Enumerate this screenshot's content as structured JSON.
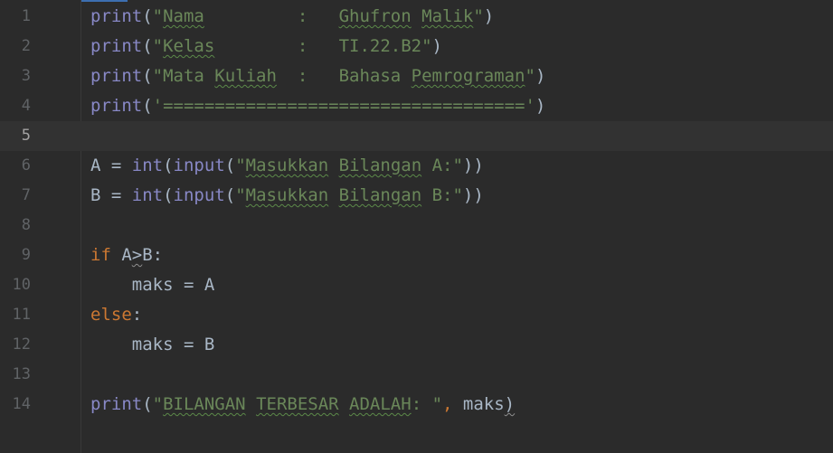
{
  "editor": {
    "colors": {
      "background": "#2b2b2b",
      "current_line": "#323232",
      "function": "#8888c6",
      "string": "#6a8759",
      "keyword": "#cc7832",
      "text": "#a9b7c6",
      "line_number": "#606366"
    },
    "current_line": 5,
    "lines": [
      {
        "num": "1",
        "tokens": [
          {
            "t": "print",
            "c": "fn"
          },
          {
            "t": "(",
            "c": "punc"
          },
          {
            "t": "\"",
            "c": "str"
          },
          {
            "t": "Nama",
            "c": "str typo"
          },
          {
            "t": "         :   ",
            "c": "str"
          },
          {
            "t": "Ghufron",
            "c": "str typo"
          },
          {
            "t": " ",
            "c": "str"
          },
          {
            "t": "Malik",
            "c": "str typo"
          },
          {
            "t": "\"",
            "c": "str"
          },
          {
            "t": ")",
            "c": "punc"
          }
        ]
      },
      {
        "num": "2",
        "tokens": [
          {
            "t": "print",
            "c": "fn"
          },
          {
            "t": "(",
            "c": "punc"
          },
          {
            "t": "\"",
            "c": "str"
          },
          {
            "t": "Kelas",
            "c": "str typo"
          },
          {
            "t": "        :   TI.22.B2\"",
            "c": "str"
          },
          {
            "t": ")",
            "c": "punc"
          }
        ]
      },
      {
        "num": "3",
        "tokens": [
          {
            "t": "print",
            "c": "fn"
          },
          {
            "t": "(",
            "c": "punc"
          },
          {
            "t": "\"Mata ",
            "c": "str"
          },
          {
            "t": "Kuliah",
            "c": "str typo"
          },
          {
            "t": "  :   Bahasa ",
            "c": "str"
          },
          {
            "t": "Pemrograman",
            "c": "str typo"
          },
          {
            "t": "\"",
            "c": "str"
          },
          {
            "t": ")",
            "c": "punc"
          }
        ]
      },
      {
        "num": "4",
        "tokens": [
          {
            "t": "print",
            "c": "fn"
          },
          {
            "t": "(",
            "c": "punc"
          },
          {
            "t": "'==================================='",
            "c": "str"
          },
          {
            "t": ")",
            "c": "punc"
          }
        ]
      },
      {
        "num": "5",
        "tokens": []
      },
      {
        "num": "6",
        "tokens": [
          {
            "t": "A = ",
            "c": "punc"
          },
          {
            "t": "int",
            "c": "fn"
          },
          {
            "t": "(",
            "c": "punc"
          },
          {
            "t": "input",
            "c": "fn"
          },
          {
            "t": "(",
            "c": "punc"
          },
          {
            "t": "\"",
            "c": "str"
          },
          {
            "t": "Masukkan",
            "c": "str typo"
          },
          {
            "t": " ",
            "c": "str"
          },
          {
            "t": "Bilangan",
            "c": "str typo"
          },
          {
            "t": " A:\"",
            "c": "str"
          },
          {
            "t": "))",
            "c": "punc"
          }
        ]
      },
      {
        "num": "7",
        "tokens": [
          {
            "t": "B = ",
            "c": "punc"
          },
          {
            "t": "int",
            "c": "fn"
          },
          {
            "t": "(",
            "c": "punc"
          },
          {
            "t": "input",
            "c": "fn"
          },
          {
            "t": "(",
            "c": "punc"
          },
          {
            "t": "\"",
            "c": "str"
          },
          {
            "t": "Masukkan",
            "c": "str typo"
          },
          {
            "t": " ",
            "c": "str"
          },
          {
            "t": "Bilangan",
            "c": "str typo"
          },
          {
            "t": " B:\"",
            "c": "str"
          },
          {
            "t": "))",
            "c": "punc"
          }
        ]
      },
      {
        "num": "8",
        "tokens": []
      },
      {
        "num": "9",
        "tokens": [
          {
            "t": "if",
            "c": "kw"
          },
          {
            "t": " A",
            "c": "punc"
          },
          {
            "t": ">",
            "c": "punc warn"
          },
          {
            "t": "B:",
            "c": "punc"
          }
        ]
      },
      {
        "num": "10",
        "tokens": [
          {
            "t": "    maks = A",
            "c": "punc"
          }
        ]
      },
      {
        "num": "11",
        "tokens": [
          {
            "t": "else",
            "c": "kw"
          },
          {
            "t": ":",
            "c": "punc"
          }
        ]
      },
      {
        "num": "12",
        "tokens": [
          {
            "t": "    maks = B",
            "c": "punc"
          }
        ]
      },
      {
        "num": "13",
        "tokens": []
      },
      {
        "num": "14",
        "tokens": [
          {
            "t": "print",
            "c": "fn"
          },
          {
            "t": "(",
            "c": "punc"
          },
          {
            "t": "\"",
            "c": "str"
          },
          {
            "t": "BILANGAN",
            "c": "str typo"
          },
          {
            "t": " ",
            "c": "str"
          },
          {
            "t": "TERBESAR",
            "c": "str typo"
          },
          {
            "t": " ",
            "c": "str"
          },
          {
            "t": "ADALAH",
            "c": "str typo"
          },
          {
            "t": ": \"",
            "c": "str"
          },
          {
            "t": ",",
            "c": "kw"
          },
          {
            "t": " maks",
            "c": "punc"
          },
          {
            "t": ")",
            "c": "punc warn"
          }
        ]
      }
    ]
  }
}
